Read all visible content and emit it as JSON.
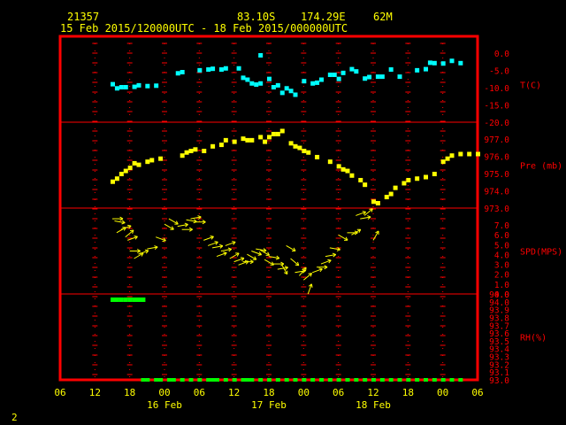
{
  "header": {
    "station": "21357",
    "lat": "83.10S",
    "lon": "174.29E",
    "elev": "62M",
    "period": "15 Feb 2015/120000UTC - 18 Feb 2015/000000UTC"
  },
  "footer": {
    "page": "2"
  },
  "colors": {
    "frame": "#ff0000",
    "text": "#ffff00",
    "temp": "#00ffff",
    "pres": "#ffff00",
    "wind": "#ffff00",
    "rh": "#00ff00"
  },
  "chart_data": {
    "type": "meteogram",
    "x_axis": {
      "tick_labels": [
        "06",
        "12",
        "18",
        "00",
        "06",
        "12",
        "18",
        "00",
        "06",
        "12",
        "18",
        "00",
        "06"
      ],
      "date_labels": [
        "16 Feb",
        "17 Feb",
        "18 Feb"
      ]
    },
    "panels": [
      {
        "name": "temperature",
        "ylabel": "T(C)",
        "ylim": [
          -20,
          0
        ],
        "ticks": [
          "0.0",
          "-5.0",
          "-10.0",
          "-15.0",
          "-20.0"
        ],
        "marker": "square",
        "color": "#00ffff",
        "points": [
          [
            12,
            -11.2
          ],
          [
            13,
            -12.3
          ],
          [
            14,
            -12.0
          ],
          [
            15,
            -12.0
          ],
          [
            17,
            -11.9
          ],
          [
            18,
            -11.5
          ],
          [
            20,
            -11.7
          ],
          [
            22,
            -11.6
          ],
          [
            27,
            -8.3
          ],
          [
            28,
            -8.0
          ],
          [
            32,
            -7.5
          ],
          [
            34,
            -7.3
          ],
          [
            35,
            -7.1
          ],
          [
            37,
            -7.3
          ],
          [
            38,
            -7.0
          ],
          [
            41,
            -7.0
          ],
          [
            42,
            -9.5
          ],
          [
            43,
            -10.0
          ],
          [
            44,
            -11.0
          ],
          [
            45,
            -11.3
          ],
          [
            46,
            -11.0
          ],
          [
            48,
            -9.8
          ],
          [
            49,
            -12.0
          ],
          [
            50,
            -11.5
          ],
          [
            51,
            -13.5
          ],
          [
            52,
            -12.3
          ],
          [
            53,
            -13.0
          ],
          [
            54,
            -14.0
          ],
          [
            56,
            -10.4
          ],
          [
            58,
            -11.0
          ],
          [
            59,
            -10.8
          ],
          [
            60,
            -10.0
          ],
          [
            62,
            -8.7
          ],
          [
            63,
            -8.7
          ],
          [
            64,
            -9.8
          ],
          [
            65,
            -8.2
          ],
          [
            67,
            -7.2
          ],
          [
            68,
            -7.8
          ],
          [
            70,
            -9.7
          ],
          [
            71,
            -9.3
          ],
          [
            73,
            -9.2
          ],
          [
            74,
            -9.2
          ],
          [
            76,
            -7.3
          ],
          [
            78,
            -9.2
          ],
          [
            82,
            -7.5
          ],
          [
            84,
            -7.2
          ],
          [
            85,
            -5.5
          ],
          [
            86,
            -5.6
          ],
          [
            88,
            -5.7
          ],
          [
            90,
            -5.0
          ],
          [
            92,
            -5.6
          ],
          [
            46,
            0.0
          ]
        ]
      },
      {
        "name": "pressure",
        "ylabel": "Pre (mb)",
        "ylim": [
          973,
          977.9
        ],
        "ticks": [
          "977.0",
          "976.0",
          "975.0",
          "974.0",
          "973.0"
        ],
        "marker": "square",
        "color": "#ffff00",
        "points": [
          [
            12,
            974.4
          ],
          [
            13,
            974.6
          ],
          [
            14,
            974.9
          ],
          [
            15,
            975.1
          ],
          [
            16,
            975.3
          ],
          [
            17,
            975.6
          ],
          [
            18,
            975.5
          ],
          [
            20,
            975.7
          ],
          [
            21,
            975.8
          ],
          [
            23,
            975.9
          ],
          [
            28,
            976.1
          ],
          [
            29,
            976.3
          ],
          [
            30,
            976.4
          ],
          [
            31,
            976.5
          ],
          [
            33,
            976.4
          ],
          [
            35,
            976.7
          ],
          [
            37,
            976.8
          ],
          [
            38,
            977.1
          ],
          [
            40,
            977.0
          ],
          [
            42,
            977.2
          ],
          [
            43,
            977.1
          ],
          [
            44,
            977.1
          ],
          [
            46,
            977.3
          ],
          [
            47,
            977.0
          ],
          [
            48,
            977.3
          ],
          [
            49,
            977.5
          ],
          [
            50,
            977.5
          ],
          [
            51,
            977.7
          ],
          [
            53,
            976.9
          ],
          [
            54,
            976.7
          ],
          [
            55,
            976.6
          ],
          [
            56,
            976.4
          ],
          [
            57,
            976.3
          ],
          [
            59,
            976.0
          ],
          [
            62,
            975.7
          ],
          [
            64,
            975.4
          ],
          [
            65,
            975.2
          ],
          [
            66,
            975.1
          ],
          [
            67,
            974.8
          ],
          [
            69,
            974.5
          ],
          [
            70,
            974.2
          ],
          [
            72,
            973.1
          ],
          [
            73,
            973.0
          ],
          [
            75,
            973.4
          ],
          [
            76,
            973.6
          ],
          [
            77,
            974.0
          ],
          [
            79,
            974.3
          ],
          [
            80,
            974.5
          ],
          [
            82,
            974.6
          ],
          [
            84,
            974.7
          ],
          [
            86,
            974.9
          ],
          [
            88,
            975.7
          ],
          [
            89,
            975.9
          ],
          [
            90,
            976.1
          ],
          [
            92,
            976.2
          ],
          [
            94,
            976.2
          ],
          [
            96,
            976.2
          ]
        ]
      },
      {
        "name": "wind",
        "ylabel": "SPD(MPS)",
        "ylim": [
          0,
          7
        ],
        "ticks": [
          "7.0",
          "6.0",
          "5.0",
          "4.0",
          "3.0",
          "2.0",
          "1.0",
          "0.0"
        ],
        "marker": "arrow",
        "color": "#ffff00",
        "arrows": [
          [
            12,
            6.5,
            270
          ],
          [
            12.5,
            6.3,
            280
          ],
          [
            13,
            5.2,
            240
          ],
          [
            14,
            5.5,
            250
          ],
          [
            15,
            4.8,
            230
          ],
          [
            15.5,
            4.5,
            250
          ],
          [
            16,
            3.5,
            270
          ],
          [
            17,
            2.8,
            240
          ],
          [
            18,
            3.2,
            250
          ],
          [
            20,
            3.7,
            260
          ],
          [
            22,
            4.8,
            290
          ],
          [
            24,
            6.0,
            300
          ],
          [
            25,
            6.5,
            300
          ],
          [
            27,
            5.8,
            260
          ],
          [
            28,
            5.5,
            270
          ],
          [
            29,
            6.4,
            280
          ],
          [
            30,
            6.5,
            260
          ],
          [
            31,
            6.2,
            270
          ],
          [
            33,
            4.5,
            250
          ],
          [
            34,
            4.0,
            250
          ],
          [
            35,
            3.8,
            260
          ],
          [
            36,
            3.0,
            250
          ],
          [
            37,
            3.5,
            260
          ],
          [
            38,
            4.0,
            250
          ],
          [
            39,
            2.8,
            240
          ],
          [
            40,
            2.5,
            250
          ],
          [
            41,
            2.2,
            250
          ],
          [
            42,
            2.5,
            270
          ],
          [
            43,
            3.2,
            300
          ],
          [
            44,
            3.5,
            290
          ],
          [
            45,
            3.7,
            280
          ],
          [
            46,
            3.6,
            300
          ],
          [
            47,
            2.7,
            300
          ],
          [
            48,
            3.0,
            280
          ],
          [
            49,
            2.3,
            270
          ],
          [
            50,
            1.8,
            260
          ],
          [
            51,
            2.2,
            330
          ],
          [
            52,
            4.0,
            300
          ],
          [
            53,
            2.8,
            310
          ],
          [
            54,
            1.5,
            260
          ],
          [
            55,
            1.2,
            220
          ],
          [
            56,
            0.8,
            230
          ],
          [
            57,
            -0.5,
            200
          ],
          [
            58,
            1.5,
            250
          ],
          [
            59,
            2.0,
            270
          ],
          [
            60,
            2.3,
            250
          ],
          [
            61,
            3.0,
            260
          ],
          [
            62,
            3.8,
            280
          ],
          [
            64,
            5.0,
            300
          ],
          [
            66,
            5.2,
            270
          ],
          [
            67,
            5.0,
            240
          ],
          [
            68,
            6.8,
            250
          ],
          [
            69,
            6.5,
            260
          ],
          [
            70,
            6.8,
            230
          ],
          [
            72,
            4.5,
            210
          ]
        ]
      },
      {
        "name": "humidity",
        "ylabel": "RH(%)",
        "ylim": [
          93.0,
          94.0
        ],
        "ticks": [
          "94.0",
          "94.0",
          "93.9",
          "93.8",
          "93.7",
          "93.6",
          "93.5",
          "93.4",
          "93.3",
          "93.2",
          "93.1",
          "93.0"
        ],
        "marker": "square",
        "color": "#00ff00",
        "points": [
          [
            12,
            94.0
          ],
          [
            13,
            94.0
          ],
          [
            14,
            94.0
          ],
          [
            15,
            94.0
          ],
          [
            16,
            94.0
          ],
          [
            17,
            94.0
          ],
          [
            18,
            94.0
          ],
          [
            19,
            94.0
          ]
        ],
        "bottom_marks": [
          [
            19,
            93.0
          ],
          [
            20,
            93.0
          ],
          [
            22,
            93.0
          ],
          [
            23,
            93.0
          ],
          [
            25,
            93.0
          ],
          [
            26,
            93.0
          ],
          [
            28,
            93.0
          ],
          [
            30,
            93.0
          ],
          [
            32,
            93.0
          ],
          [
            34,
            93.0
          ],
          [
            35,
            93.0
          ],
          [
            36,
            93.0
          ],
          [
            38,
            93.0
          ],
          [
            40,
            93.0
          ],
          [
            42,
            93.0
          ],
          [
            43,
            93.0
          ],
          [
            44,
            93.0
          ],
          [
            46,
            93.0
          ],
          [
            48,
            93.0
          ],
          [
            50,
            93.0
          ],
          [
            52,
            93.0
          ],
          [
            54,
            93.0
          ],
          [
            56,
            93.0
          ],
          [
            58,
            93.0
          ],
          [
            60,
            93.0
          ],
          [
            62,
            93.0
          ],
          [
            64,
            93.0
          ],
          [
            66,
            93.0
          ],
          [
            68,
            93.0
          ],
          [
            70,
            93.0
          ],
          [
            72,
            93.0
          ],
          [
            74,
            93.0
          ],
          [
            76,
            93.0
          ],
          [
            78,
            93.0
          ],
          [
            80,
            93.0
          ],
          [
            82,
            93.0
          ],
          [
            84,
            93.0
          ],
          [
            86,
            93.0
          ],
          [
            88,
            93.0
          ],
          [
            90,
            93.0
          ],
          [
            92,
            93.0
          ]
        ]
      }
    ]
  }
}
